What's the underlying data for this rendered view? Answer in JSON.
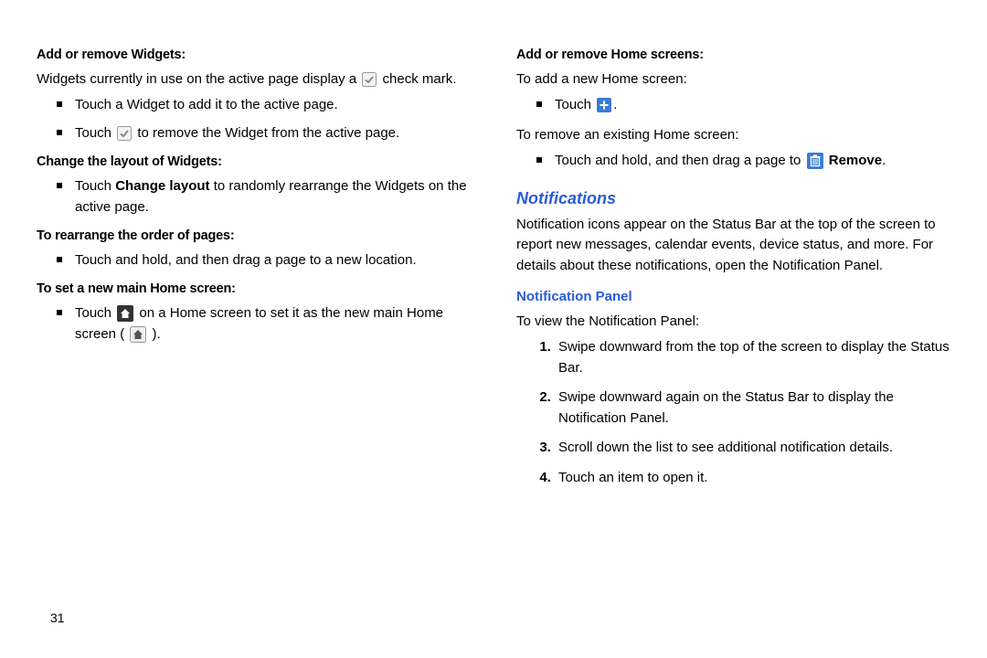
{
  "pageNumber": "31",
  "left": {
    "h1": "Add or remove Widgets:",
    "p1_a": "Widgets currently in use on the active page display a",
    "p1_b": " check mark.",
    "b1": "Touch a Widget to add it to the active page.",
    "b2_a": "Touch ",
    "b2_b": " to remove the Widget from the active page.",
    "h2": "Change the layout of Widgets:",
    "b3_a": "Touch ",
    "b3_strong": "Change layout",
    "b3_b": " to randomly rearrange the Widgets on the active page.",
    "h3": "To rearrange the order of pages:",
    "b4": "Touch and hold, and then drag a page to a new location.",
    "h4": "To set a new main Home screen:",
    "b5_a": "Touch ",
    "b5_b": " on a Home screen to set it as the new main Home screen ( ",
    "b5_c": " )."
  },
  "right": {
    "h1": "Add or remove Home screens:",
    "p1": "To add a new Home screen:",
    "b1_a": "Touch ",
    "b1_b": ".",
    "p2": "To remove an existing Home screen:",
    "b2_a": "Touch and hold, and then drag a page to ",
    "b2_strong": "Remove",
    "b2_b": ".",
    "sec": "Notifications",
    "secPara": "Notification icons appear on the Status Bar at the top of the screen to report new messages, calendar events, device status, and more. For details about these notifications, open the Notification Panel.",
    "sub": "Notification Panel",
    "subPara": "To view the Notification Panel:",
    "n1": "Swipe downward from the top of the screen to display the Status Bar.",
    "n2": "Swipe downward again on the Status Bar to display the Notification Panel.",
    "n3": "Scroll down the list to see additional notification details.",
    "n4": "Touch an item to open it."
  }
}
